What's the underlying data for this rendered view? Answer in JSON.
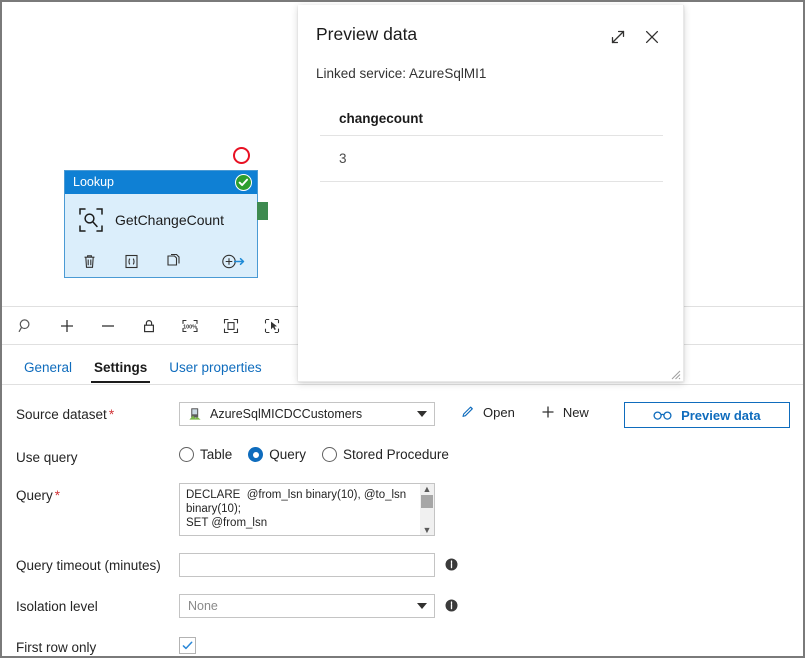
{
  "canvas": {
    "activity": {
      "type_label": "Lookup",
      "name": "GetChangeCount",
      "status_icon": "success-check-icon",
      "footer_icons": [
        "delete-icon",
        "code-icon",
        "clone-icon",
        "add-output-icon"
      ],
      "error_marker_icon": "red-circle-icon",
      "output_connector_icon": "green-connector-icon"
    }
  },
  "zoom_toolbar": {
    "buttons": [
      {
        "name": "zoom-search-icon",
        "title": "Search"
      },
      {
        "name": "zoom-in-icon",
        "title": "Zoom in"
      },
      {
        "name": "zoom-out-icon",
        "title": "Zoom out"
      },
      {
        "name": "lock-icon",
        "title": "Lock canvas"
      },
      {
        "name": "zoom-100-icon",
        "title": "Zoom to 100%"
      },
      {
        "name": "fit-to-screen-icon",
        "title": "Fit to screen"
      },
      {
        "name": "auto-align-icon",
        "title": "Auto align"
      }
    ],
    "zoom_level_label": "100%"
  },
  "tabs": [
    {
      "label": "General",
      "active": false
    },
    {
      "label": "Settings",
      "active": true
    },
    {
      "label": "User properties",
      "active": false
    }
  ],
  "settings": {
    "source_dataset": {
      "label": "Source dataset",
      "required": true,
      "value": "AzureSqlMICDCCustomers",
      "dataset_icon": "database-icon",
      "open_label": "Open",
      "open_icon": "pencil-icon",
      "new_label": "New",
      "new_icon": "plus-icon",
      "preview_label": "Preview data",
      "preview_icon": "glasses-icon"
    },
    "use_query": {
      "label": "Use query",
      "options": [
        "Table",
        "Query",
        "Stored Procedure"
      ],
      "selected": "Query"
    },
    "query": {
      "label": "Query",
      "required": true,
      "value": "DECLARE  @from_lsn binary(10), @to_lsn\nbinary(10);\nSET @from_lsn"
    },
    "query_timeout": {
      "label": "Query timeout (minutes)",
      "value": "",
      "placeholder": "",
      "info_icon": "info-icon"
    },
    "isolation_level": {
      "label": "Isolation level",
      "value": "None",
      "is_placeholder": true,
      "info_icon": "info-icon"
    },
    "first_row_only": {
      "label": "First row only",
      "checked": true
    }
  },
  "preview_panel": {
    "title": "Preview data",
    "expand_icon": "expand-diagonal-icon",
    "close_icon": "close-icon",
    "linked_service": "Linked service: AzureSqlMI1",
    "table": {
      "columns": [
        "changecount"
      ],
      "rows": [
        [
          "3"
        ]
      ]
    },
    "resize_grip_icon": "resize-grip-icon"
  },
  "colors": {
    "accent_blue": "#0f6cbd",
    "node_header_blue": "#0f80d4",
    "node_body_blue": "#dbeefb",
    "success_green": "#2e9e2e",
    "connector_green": "#3e8a4f",
    "error_red": "#e81123",
    "required_red": "#d13438"
  }
}
